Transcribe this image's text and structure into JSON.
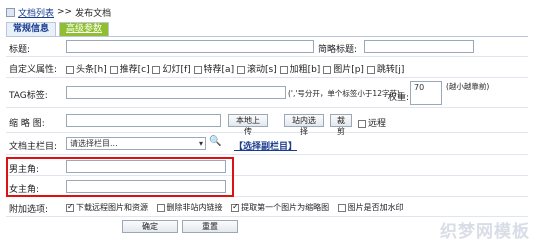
{
  "breadcrumb": {
    "list_link": "文档列表",
    "sep": ">>",
    "current": "发布文档"
  },
  "tabs": [
    {
      "label": "常规信息"
    },
    {
      "label": "高级参数"
    }
  ],
  "form": {
    "title_label": "标题:",
    "short_title_label": "简略标题:",
    "attr_label": "自定义属性:",
    "attrs": [
      "头条[h]",
      "推荐[c]",
      "幻灯[f]",
      "特荐[a]",
      "滚动[s]",
      "加粗[b]",
      "图片[p]",
      "跳转[j]"
    ],
    "tag_label": "TAG标签:",
    "tag_hint": "(','号分开，单个标签小于12字节)",
    "weight_label": "权重:",
    "weight_value": "70",
    "weight_hint": "(越小越靠前)",
    "thumb_label": "缩 略 图:",
    "upload_btn": "本地上传",
    "site_select_btn": "站内选择",
    "crop_btn": "裁剪",
    "remote_label": "远程",
    "column_label": "文档主栏目:",
    "column_select": "请选择栏目...",
    "sub_column_link": "【选择副栏目】",
    "male_label": "男主角:",
    "female_label": "女主角:",
    "extra_label": "附加选项:",
    "extra_options": [
      {
        "label": "下载远程图片和资源",
        "checked": true
      },
      {
        "label": "删除非站内链接",
        "checked": false
      },
      {
        "label": "提取第一个图片为缩略图",
        "checked": true
      },
      {
        "label": "图片是否加水印",
        "checked": false
      }
    ],
    "submit_btn": "确定",
    "reset_btn": "重置"
  },
  "watermark": "织梦网模板",
  "colors": {
    "accent": "#1a3c8f",
    "tab_green": "#8fbf2f",
    "highlight_red": "#dd1111"
  }
}
